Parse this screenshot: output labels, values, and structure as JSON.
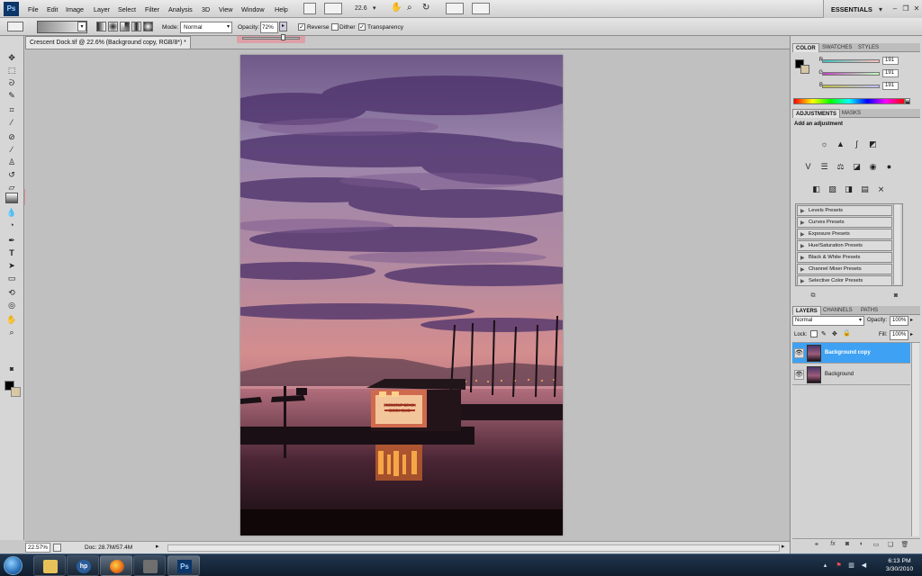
{
  "app": {
    "logo": "Ps",
    "menu": [
      "File",
      "Edit",
      "Image",
      "Layer",
      "Select",
      "Filter",
      "Analysis",
      "3D",
      "View",
      "Window",
      "Help"
    ],
    "zoom_level": "22.6",
    "workspace": "ESSENTIALS"
  },
  "options_bar": {
    "mode_label": "Mode:",
    "mode_value": "Normal",
    "opacity_label": "Opacity:",
    "opacity_value": "72%",
    "reverse_label": "Reverse",
    "dither_label": "Dither",
    "transparency_label": "Transparency",
    "reverse_checked": true,
    "dither_checked": false,
    "transparency_checked": true
  },
  "document": {
    "tab_title": "Crescent Dock.tif @ 22.6% (Background copy, RGB/8*) *",
    "close_glyph": "×",
    "sign_text": "CRESCENT BEACH",
    "sign_text_2": "DOCK CLUB"
  },
  "status": {
    "zoom": "22.57%",
    "doc_info": "Doc: 28.7M/57.4M"
  },
  "color_panel": {
    "tabs": [
      "COLOR",
      "SWATCHES",
      "STYLES"
    ],
    "channels": [
      {
        "name": "R",
        "value": "191"
      },
      {
        "name": "G",
        "value": "191"
      },
      {
        "name": "B",
        "value": "191"
      }
    ]
  },
  "adjustments_panel": {
    "tabs": [
      "ADJUSTMENTS",
      "MASKS"
    ],
    "heading": "Add an adjustment",
    "presets": [
      "Levels Presets",
      "Curves Presets",
      "Exposure Presets",
      "Hue/Saturation Presets",
      "Black & White Presets",
      "Channel Mixer Presets",
      "Selective Color Presets"
    ]
  },
  "layers_panel": {
    "tabs": [
      "LAYERS",
      "CHANNELS",
      "PATHS"
    ],
    "blend_mode": "Normal",
    "opacity_label": "Opacity:",
    "opacity_value": "100%",
    "lock_label": "Lock:",
    "fill_label": "Fill:",
    "fill_value": "100%",
    "layers": [
      {
        "name": "Background copy",
        "selected": true
      },
      {
        "name": "Background",
        "selected": false
      }
    ]
  },
  "taskbar": {
    "time": "6:13 PM",
    "date": "3/30/2010",
    "ps_label": "Ps"
  },
  "icons": [
    "move-icon",
    "marquee-icon",
    "lasso-icon",
    "quick-select-icon",
    "crop-icon",
    "eyedropper-icon",
    "healing-icon",
    "brush-icon",
    "stamp-icon",
    "history-brush-icon",
    "eraser-icon",
    "gradient-icon",
    "blur-icon",
    "dodge-icon",
    "pen-icon",
    "type-icon",
    "path-select-icon",
    "shape-icon",
    "3d-rotate-icon",
    "3d-orbit-icon",
    "hand-icon",
    "zoom-icon"
  ]
}
